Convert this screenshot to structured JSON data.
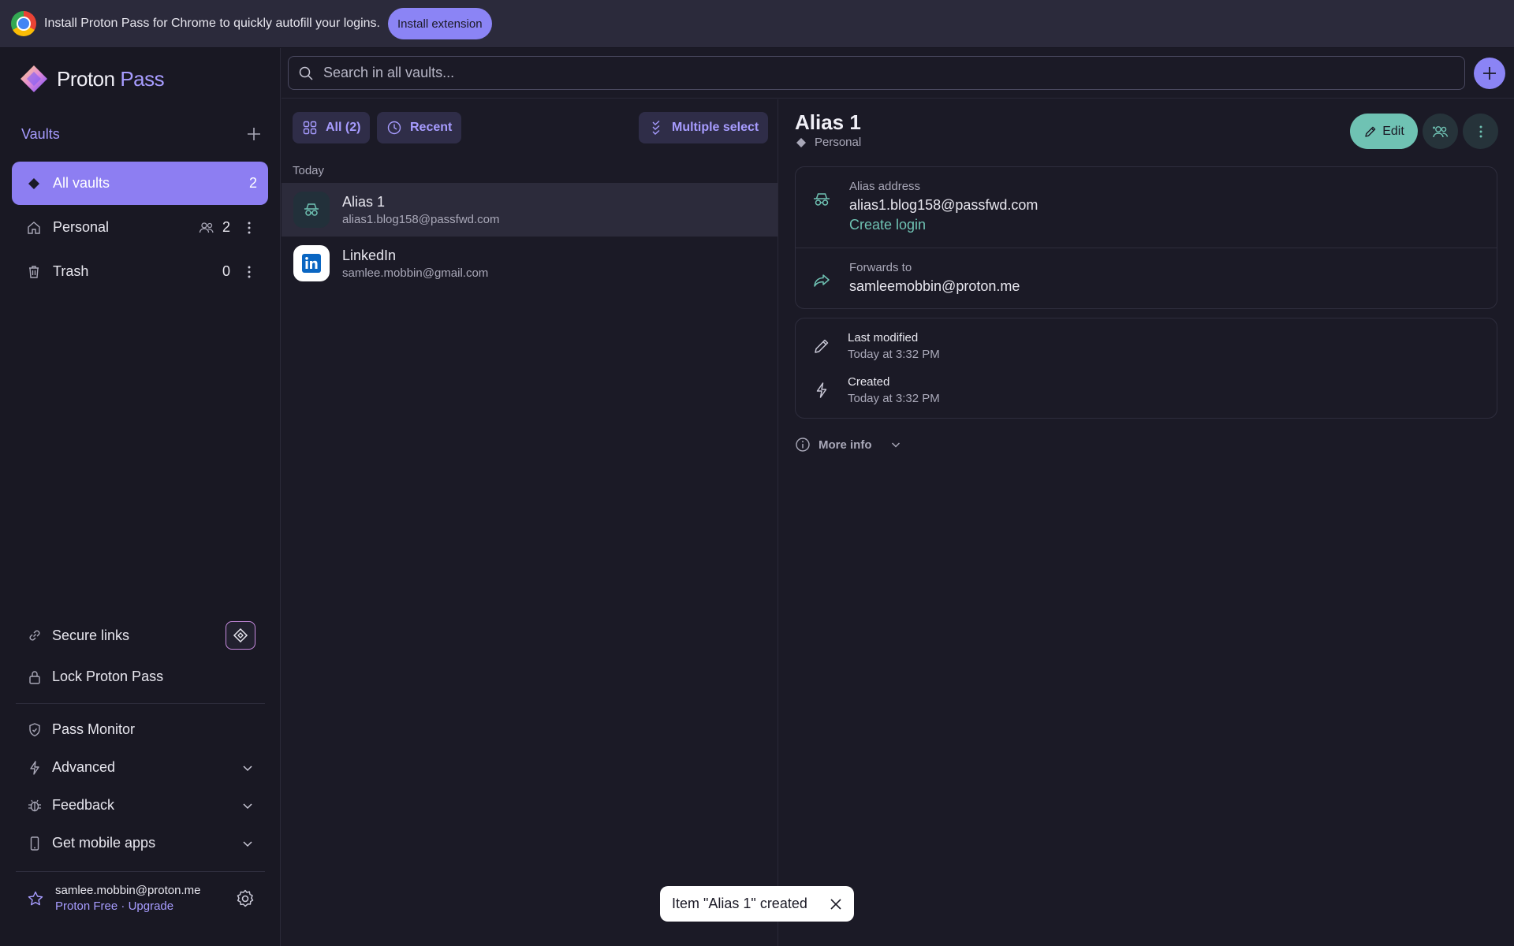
{
  "banner": {
    "message": "Install Proton Pass for Chrome to quickly autofill your logins.",
    "install_label": "Install extension"
  },
  "brand": {
    "name_part1": "Proton",
    "name_part2": "Pass"
  },
  "sidebar": {
    "vaults_title": "Vaults",
    "vaults": [
      {
        "label": "All vaults",
        "count": "2"
      },
      {
        "label": "Personal",
        "count": "2"
      },
      {
        "label": "Trash",
        "count": "0"
      }
    ],
    "secure_links": "Secure links",
    "lock": "Lock Proton Pass",
    "pass_monitor": "Pass Monitor",
    "advanced": "Advanced",
    "feedback": "Feedback",
    "mobile_apps": "Get mobile apps",
    "account": {
      "email": "samlee.mobbin@proton.me",
      "plan": "Proton Free",
      "separator": "·",
      "upgrade": "Upgrade"
    }
  },
  "search": {
    "placeholder": "Search in all vaults..."
  },
  "list": {
    "filter_all": "All (2)",
    "filter_recent": "Recent",
    "multi_select": "Multiple select",
    "group_label": "Today",
    "items": [
      {
        "title": "Alias 1",
        "subtitle": "alias1.blog158@passfwd.com",
        "icon": "alias-icon"
      },
      {
        "title": "LinkedIn",
        "subtitle": "samlee.mobbin@gmail.com",
        "icon": "linkedin-icon"
      }
    ]
  },
  "detail": {
    "title": "Alias 1",
    "vault": "Personal",
    "edit_label": "Edit",
    "alias_address_label": "Alias address",
    "alias_address": "alias1.blog158@passfwd.com",
    "create_login": "Create login",
    "forwards_to_label": "Forwards to",
    "forwards_to": "samleemobbin@proton.me",
    "last_modified_label": "Last modified",
    "last_modified": "Today at 3:32 PM",
    "created_label": "Created",
    "created": "Today at 3:32 PM",
    "more_info": "More info"
  },
  "toast": {
    "message": "Item \"Alias 1\" created"
  },
  "colors": {
    "accent": "#8d7ef2",
    "accent_text": "#a79cff",
    "teal": "#6fc2b3",
    "background": "#1b1a26",
    "sidebar": "#191823"
  }
}
